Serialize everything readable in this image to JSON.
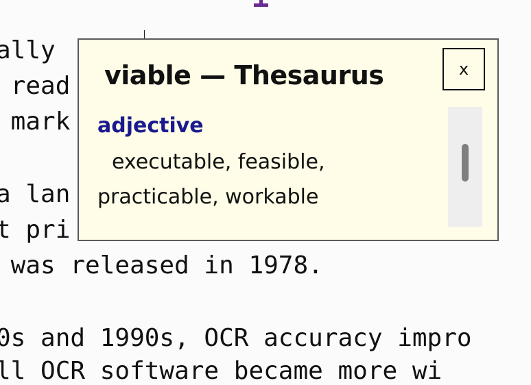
{
  "document": {
    "lines": [
      "ally                       d",
      " read                     rt",
      " mark                     ar",
      "",
      "a lan                     4",
      "t pri                     t.",
      " was released in 1978.",
      "",
      "0s and 1990s, OCR accuracy impro",
      "ll OCR software became more wi"
    ]
  },
  "popup": {
    "title": "viable — Thesaurus",
    "close_label": "x",
    "part_of_speech": "adjective",
    "synonyms_line1": "executable, feasible,",
    "synonyms_line2": "practicable, workable"
  }
}
